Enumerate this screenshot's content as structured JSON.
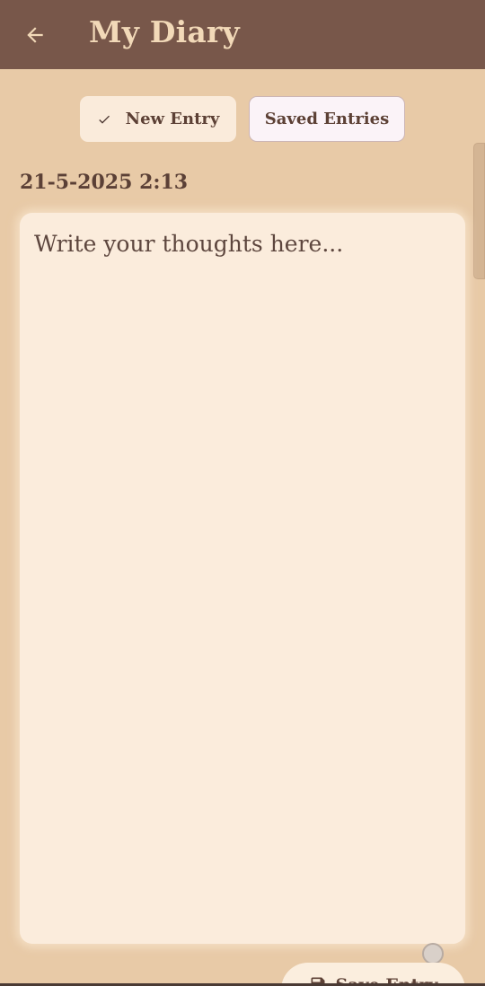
{
  "appbar": {
    "title": "My Diary",
    "back_icon": "arrow-left-icon"
  },
  "tabs": {
    "new_entry": {
      "label": "New Entry",
      "icon": "check-icon",
      "selected": true
    },
    "saved_entries": {
      "label": "Saved Entries",
      "selected": false
    }
  },
  "entry": {
    "timestamp": "21-5-2025 2:13",
    "placeholder": "Write your thoughts here...",
    "value": ""
  },
  "fab": {
    "label": "Save Entry",
    "icon": "save-icon"
  },
  "colors": {
    "appbar": "#78574a",
    "background": "#e8caa7",
    "card": "#fbecdc",
    "accent_text": "#5c4035",
    "title_text": "#f2d9b8"
  }
}
